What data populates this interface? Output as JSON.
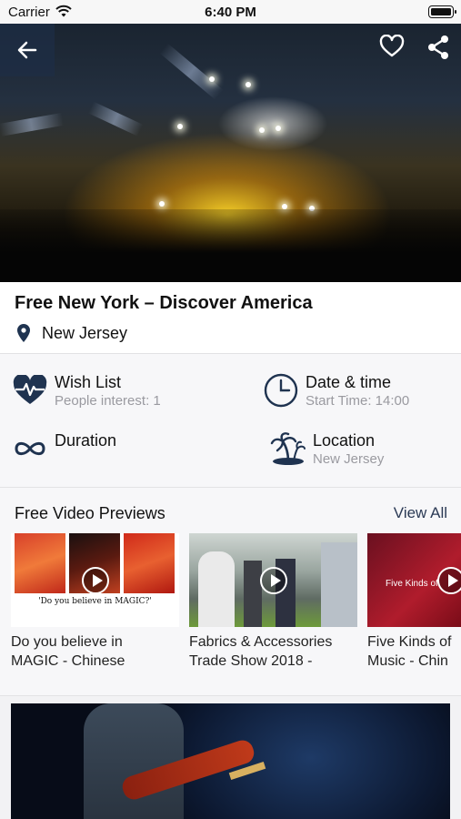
{
  "status_bar": {
    "carrier": "Carrier",
    "time": "6:40 PM"
  },
  "header": {
    "back_icon": "arrow-left-icon",
    "favorite_icon": "heart-outline-icon",
    "share_icon": "share-icon"
  },
  "event": {
    "title": "Free New York – Discover America",
    "place": "New Jersey"
  },
  "info": {
    "wish_list": {
      "label": "Wish List",
      "sub": "People interest: 1",
      "icon": "heart-pulse-icon"
    },
    "date_time": {
      "label": "Date & time",
      "sub": "Start Time: 14:00",
      "icon": "clock-icon"
    },
    "duration": {
      "label": "Duration",
      "icon": "infinity-icon"
    },
    "location": {
      "label": "Location",
      "sub": "New Jersey",
      "icon": "palm-island-icon"
    }
  },
  "videos": {
    "heading": "Free Video Previews",
    "view_all": "View All",
    "items": [
      {
        "title_line1": "Do you believe in",
        "title_line2": "MAGIC - Chinese",
        "thumb_caption": "'Do you believe in MAGIC?'"
      },
      {
        "title_line1": "Fabrics & Accessories",
        "title_line2": "Trade Show 2018 -"
      },
      {
        "title_line1": "Five Kinds of",
        "title_line2": "Music - Chin",
        "thumb_caption": "Five Kinds of"
      }
    ]
  },
  "colors": {
    "accent": "#2b3a55",
    "muted": "#9a9aa0",
    "icon": "#1f3350"
  }
}
